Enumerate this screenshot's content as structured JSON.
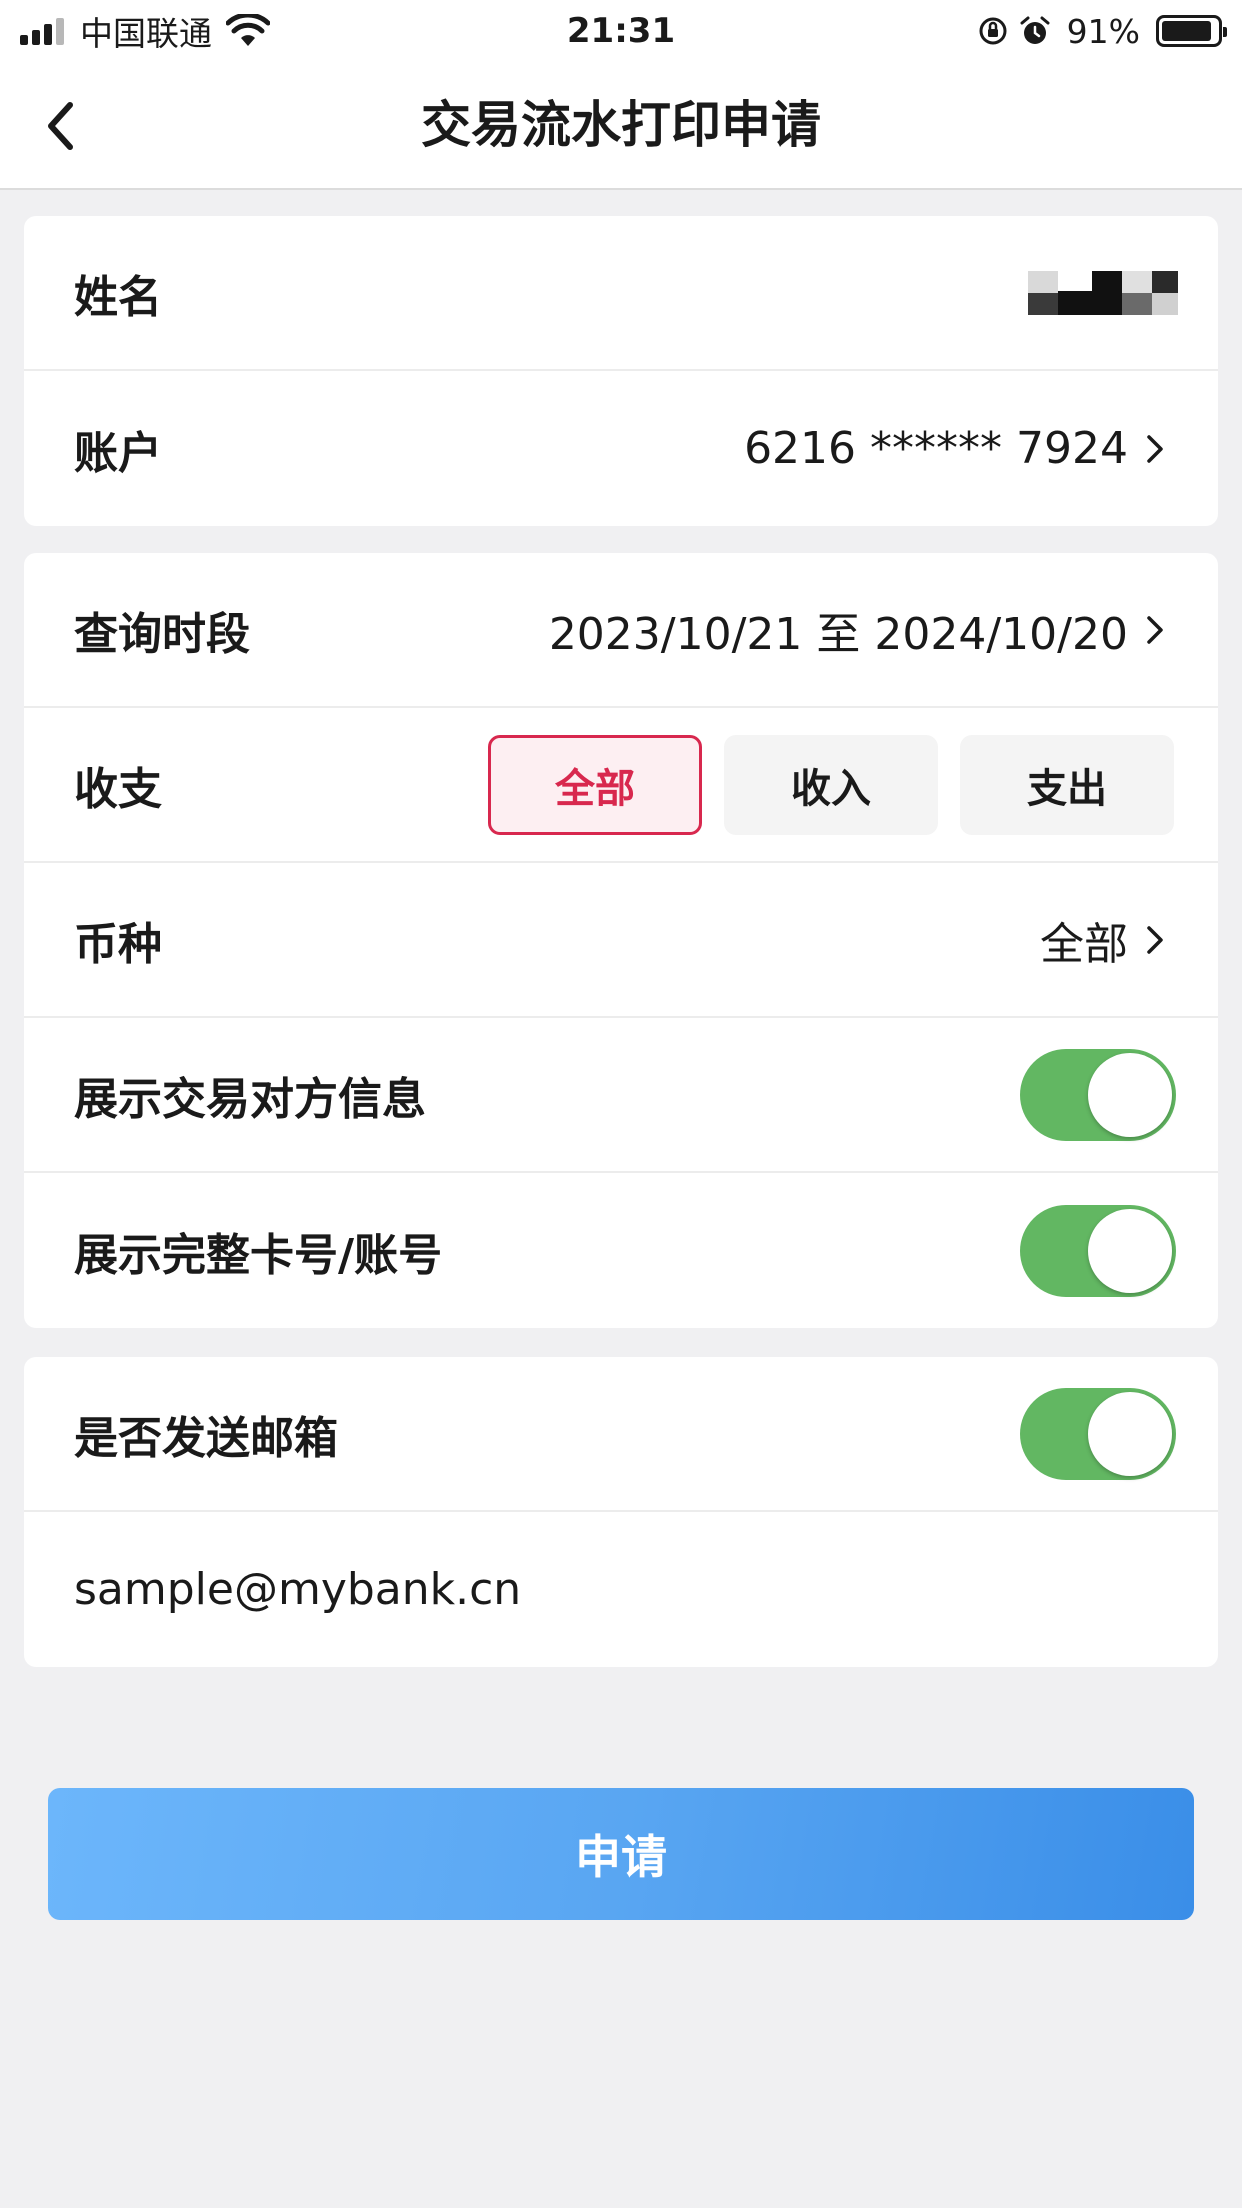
{
  "status_bar": {
    "carrier": "中国联通",
    "time": "21:31",
    "battery_percent": "91%",
    "battery_level": 0.91
  },
  "nav": {
    "title": "交易流水打印申请"
  },
  "account_card": {
    "name_label": "姓名",
    "account_label": "账户",
    "account_value": "6216 ****** 7924"
  },
  "filter_card": {
    "period_label": "查询时段",
    "period_value": "2023/10/21 至 2024/10/20",
    "type_label": "收支",
    "type_options": [
      "全部",
      "收入",
      "支出"
    ],
    "type_selected": "全部",
    "currency_label": "币种",
    "currency_value": "全部",
    "show_counterparty_label": "展示交易对方信息",
    "show_counterparty_on": true,
    "show_full_card_label": "展示完整卡号/账号",
    "show_full_card_on": true
  },
  "email_card": {
    "send_email_label": "是否发送邮箱",
    "send_email_on": true,
    "email_value": "sample@mybank.cn"
  },
  "submit_label": "申请",
  "colors": {
    "accent_red": "#d8284e",
    "toggle_green": "#62b762",
    "button_blue": "#4a9df0"
  }
}
